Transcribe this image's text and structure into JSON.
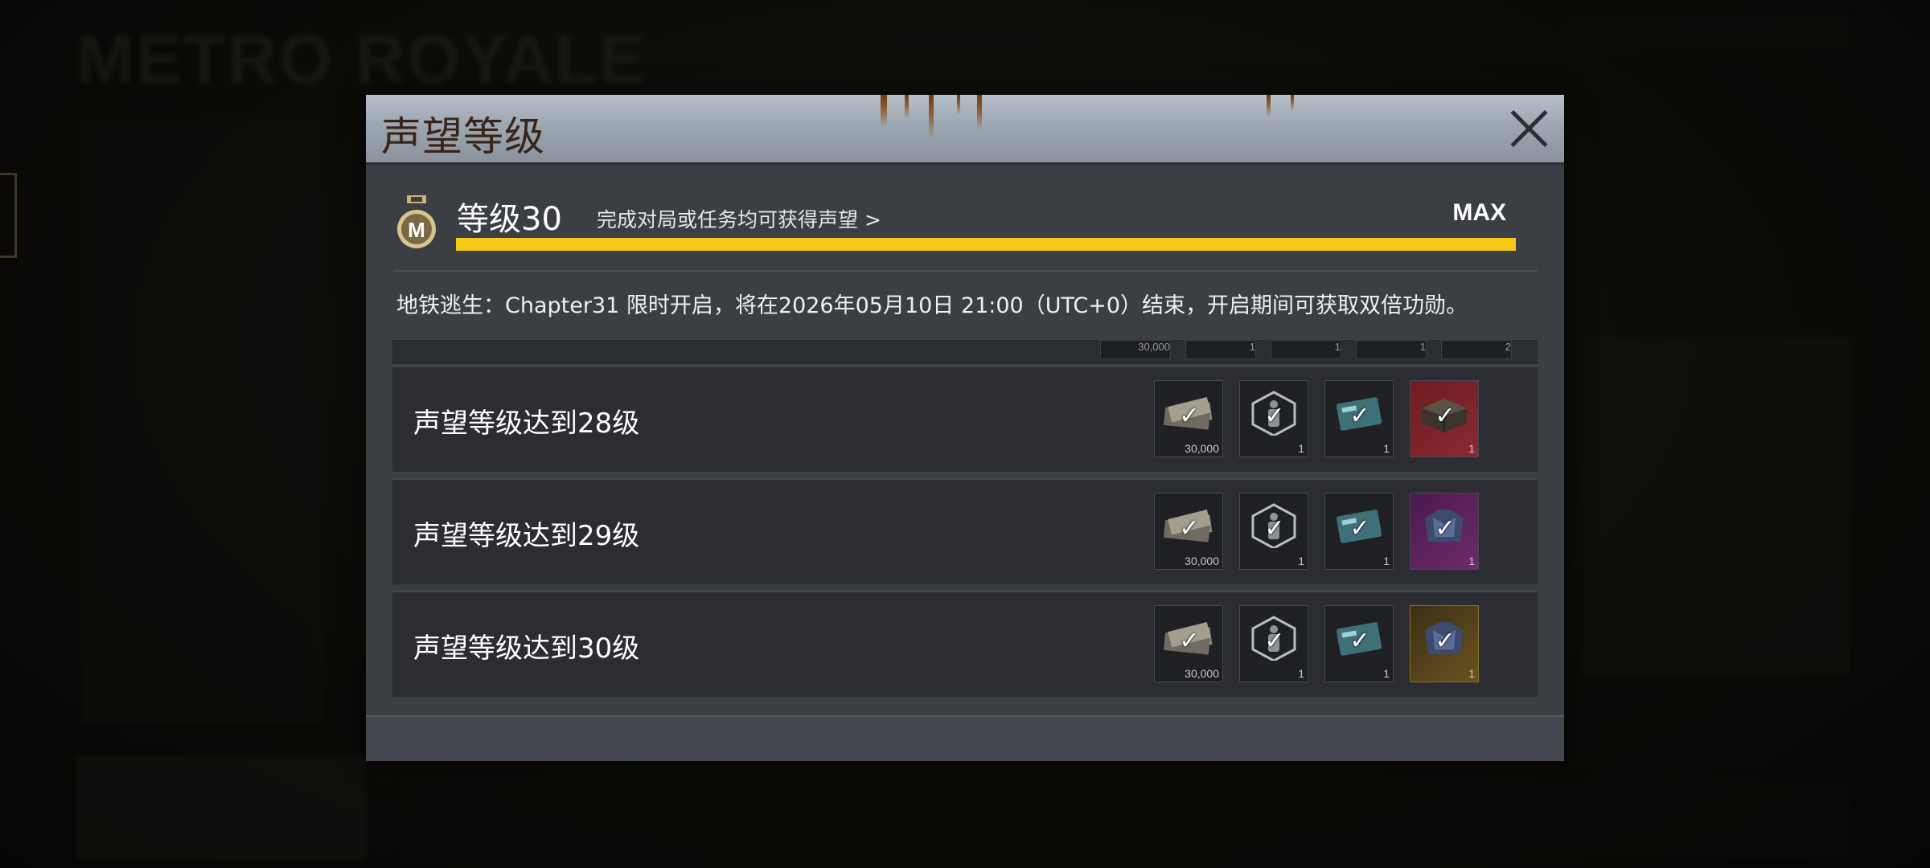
{
  "background": {
    "title": "METRO ROYALE"
  },
  "dialog": {
    "title": "声望等级",
    "level_label": "等级30",
    "level_hint": "完成对局或任务均可获得声望 >",
    "max_label": "MAX",
    "progress_fraction": 1.0,
    "event_notice": "地铁逃生：Chapter31 限时开启，将在2026年05月10日 21:00（UTC+0）结束，开启期间可获取双倍功勋。",
    "partial_row": {
      "qtys": [
        "30,000",
        "1",
        "1",
        "1",
        "2"
      ]
    },
    "rows": [
      {
        "label": "声望等级达到28级",
        "rewards": [
          {
            "icon": "cash-stack-icon",
            "qty": "30,000",
            "style": "dark"
          },
          {
            "icon": "figure-hexagon-icon",
            "qty": "1",
            "style": "dark"
          },
          {
            "icon": "blue-card-icon",
            "qty": "1",
            "style": "dark"
          },
          {
            "icon": "crate-icon",
            "qty": "1",
            "style": "red"
          }
        ]
      },
      {
        "label": "声望等级达到29级",
        "rewards": [
          {
            "icon": "cash-stack-icon",
            "qty": "30,000",
            "style": "dark"
          },
          {
            "icon": "figure-hexagon-icon",
            "qty": "1",
            "style": "dark"
          },
          {
            "icon": "blue-card-icon",
            "qty": "1",
            "style": "dark"
          },
          {
            "icon": "armor-vest-icon",
            "qty": "1",
            "style": "purple"
          }
        ]
      },
      {
        "label": "声望等级达到30级",
        "rewards": [
          {
            "icon": "cash-stack-icon",
            "qty": "30,000",
            "style": "dark"
          },
          {
            "icon": "figure-hexagon-icon",
            "qty": "1",
            "style": "dark"
          },
          {
            "icon": "blue-card-icon",
            "qty": "1",
            "style": "dark"
          },
          {
            "icon": "armor-vest-icon",
            "qty": "1",
            "style": "gold"
          }
        ]
      }
    ],
    "claimed_mark": "✓"
  }
}
